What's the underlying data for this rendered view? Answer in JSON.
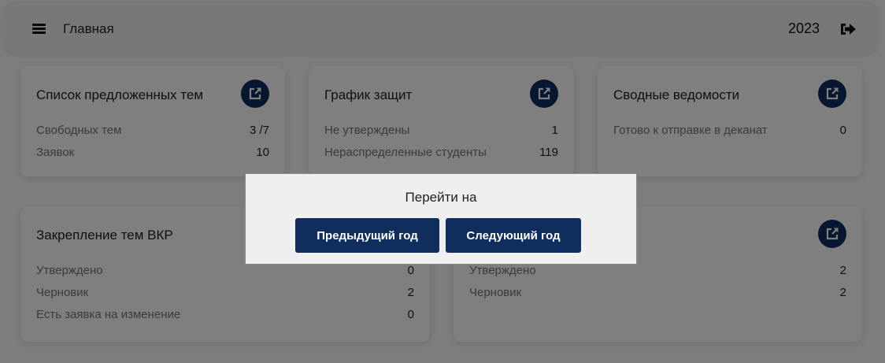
{
  "topbar": {
    "title": "Главная",
    "year": "2023"
  },
  "cards": [
    {
      "title": "Список предложенных тем",
      "rows": [
        {
          "label": "Свободных тем",
          "value": "3 /7"
        },
        {
          "label": "Заявок",
          "value": "10"
        }
      ]
    },
    {
      "title": "График защит",
      "rows": [
        {
          "label": "Не утверждены",
          "value": "1"
        },
        {
          "label": "Нераспределенные студенты",
          "value": "119"
        }
      ]
    },
    {
      "title": "Сводные ведомости",
      "rows": [
        {
          "label": "Готово к отправке в деканат",
          "value": "0"
        }
      ]
    },
    {
      "title": "Закрепление тем ВКР",
      "rows": [
        {
          "label": "Утверждено",
          "value": "0"
        },
        {
          "label": "Черновик",
          "value": "2"
        },
        {
          "label": "Есть заявка на изменение",
          "value": "0"
        }
      ]
    },
    {
      "title": "",
      "rows": [
        {
          "label": "Утверждено",
          "value": "2"
        },
        {
          "label": "Черновик",
          "value": "2"
        }
      ]
    }
  ],
  "dialog": {
    "title": "Перейти на",
    "prev_label": "Предыдущий год",
    "next_label": "Следующий год"
  },
  "colors": {
    "accent": "#0f2e5e",
    "overlay": "rgba(0,0,0,0.5)"
  },
  "icons": {
    "menu": "hamburger-icon",
    "logout": "sign-out-icon",
    "card_link": "external-link-icon"
  }
}
